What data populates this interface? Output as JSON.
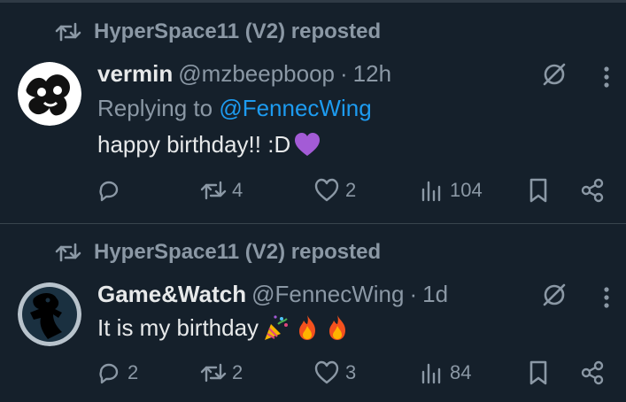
{
  "posts": [
    {
      "repost_label": "HyperSpace11 (V2) reposted",
      "author_name": "vermin",
      "handle": "@mzbeepboop",
      "separator": "·",
      "time": "12h",
      "replying_prefix": "Replying to",
      "replying_mention": "@FennecWing",
      "text": "happy birthday!! :D",
      "emojis": [
        "purple-heart"
      ],
      "actions": {
        "replies": "",
        "reposts": "4",
        "likes": "2",
        "views": "104"
      }
    },
    {
      "repost_label": "HyperSpace11 (V2) reposted",
      "author_name": "Game&Watch",
      "handle": "@FennecWing",
      "separator": "·",
      "time": "1d",
      "text": "It is my birthday",
      "emojis": [
        "party-popper",
        "fire",
        "fire"
      ],
      "actions": {
        "replies": "2",
        "reposts": "2",
        "likes": "3",
        "views": "84"
      }
    }
  ],
  "colors": {
    "background": "#15202b",
    "text_primary": "#e7e9ea",
    "text_secondary": "#8b98a5",
    "mention": "#1d9bf0",
    "divider": "#38444d"
  },
  "icons": [
    "repost-icon",
    "reply-icon",
    "like-icon",
    "views-icon",
    "bookmark-icon",
    "share-icon",
    "grok-icon",
    "more-icon"
  ]
}
